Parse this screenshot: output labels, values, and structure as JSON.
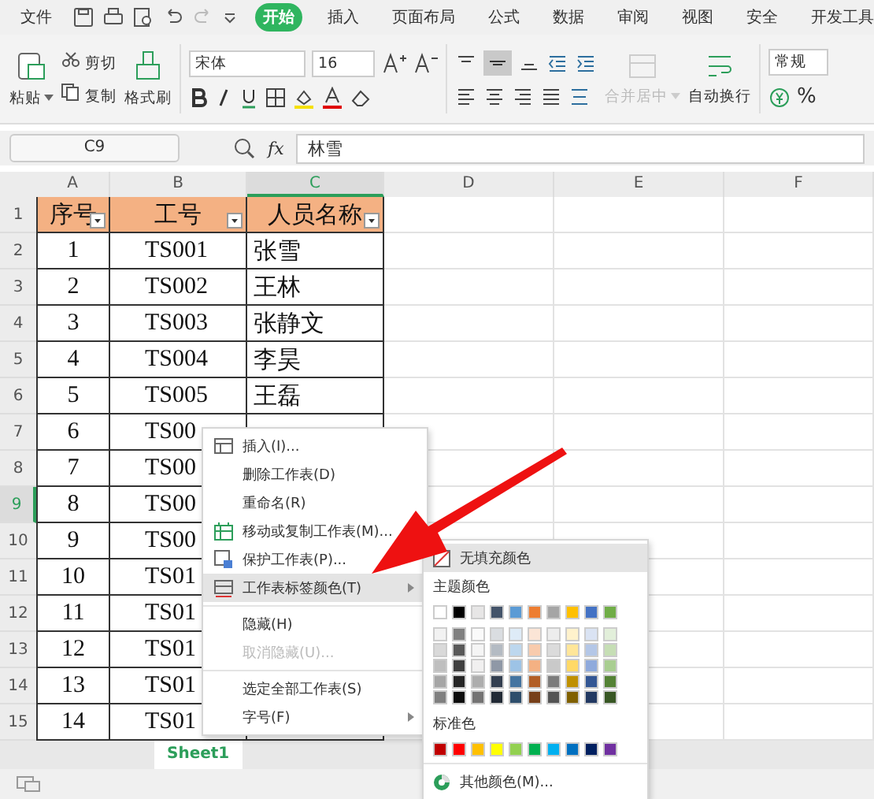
{
  "menu_bar": {
    "file": "文件",
    "tabs": [
      {
        "label": "开始",
        "selected": true
      },
      {
        "label": "插入",
        "selected": false
      },
      {
        "label": "页面布局",
        "selected": false
      },
      {
        "label": "公式",
        "selected": false
      },
      {
        "label": "数据",
        "selected": false
      },
      {
        "label": "审阅",
        "selected": false
      },
      {
        "label": "视图",
        "selected": false
      },
      {
        "label": "安全",
        "selected": false
      },
      {
        "label": "开发工具",
        "selected": false
      }
    ]
  },
  "ribbon": {
    "paste": "粘贴",
    "cut": "剪切",
    "copy": "复制",
    "format_painter": "格式刷",
    "font": "宋体",
    "font_size": "16",
    "merge": {
      "label": "合并居中",
      "disabled": true
    },
    "wrap": "自动换行",
    "number_format": "常规",
    "percent": "%"
  },
  "formula_bar": {
    "name_box": "C9",
    "fx_label": "fx",
    "formula": "林雪"
  },
  "sheet": {
    "columns": [
      {
        "label": "A",
        "selected": false
      },
      {
        "label": "B",
        "selected": false
      },
      {
        "label": "C",
        "selected": true
      },
      {
        "label": "D",
        "selected": false
      },
      {
        "label": "E",
        "selected": false
      },
      {
        "label": "F",
        "selected": false
      }
    ],
    "rows": [
      {
        "number": "1",
        "selected": false,
        "kind": "header",
        "cells": [
          "序号",
          "工号",
          "人员名称"
        ]
      },
      {
        "number": "2",
        "selected": false,
        "kind": "data",
        "cells": [
          "1",
          "TS001",
          "张雪"
        ]
      },
      {
        "number": "3",
        "selected": false,
        "kind": "data",
        "cells": [
          "2",
          "TS002",
          "王林"
        ]
      },
      {
        "number": "4",
        "selected": false,
        "kind": "data",
        "cells": [
          "3",
          "TS003",
          "张静文"
        ]
      },
      {
        "number": "5",
        "selected": false,
        "kind": "data",
        "cells": [
          "4",
          "TS004",
          "李昊"
        ]
      },
      {
        "number": "6",
        "selected": false,
        "kind": "data",
        "cells": [
          "5",
          "TS005",
          "王磊"
        ]
      },
      {
        "number": "7",
        "selected": false,
        "kind": "data",
        "cells": [
          "6",
          "TS00"
        ]
      },
      {
        "number": "8",
        "selected": false,
        "kind": "data",
        "cells": [
          "7",
          "TS00"
        ]
      },
      {
        "number": "9",
        "selected": true,
        "kind": "data",
        "cells": [
          "8",
          "TS00"
        ]
      },
      {
        "number": "10",
        "selected": false,
        "kind": "data",
        "cells": [
          "9",
          "TS00"
        ]
      },
      {
        "number": "11",
        "selected": false,
        "kind": "data",
        "cells": [
          "10",
          "TS01"
        ]
      },
      {
        "number": "12",
        "selected": false,
        "kind": "data",
        "cells": [
          "11",
          "TS01"
        ]
      },
      {
        "number": "13",
        "selected": false,
        "kind": "data",
        "cells": [
          "12",
          "TS01"
        ]
      },
      {
        "number": "14",
        "selected": false,
        "kind": "data",
        "cells": [
          "13",
          "TS01"
        ]
      },
      {
        "number": "15",
        "selected": false,
        "kind": "data",
        "cells": [
          "14",
          "TS01"
        ]
      }
    ]
  },
  "sheet_tabs": [
    {
      "label": "Sheet1",
      "selected": true
    }
  ],
  "context_menu": [
    {
      "label": "插入(I)...",
      "kind": "table",
      "disabled": false,
      "highlighted": false,
      "submenu": false
    },
    {
      "label": "删除工作表(D)",
      "kind": "plain",
      "disabled": false,
      "highlighted": false,
      "submenu": false
    },
    {
      "label": "重命名(R)",
      "kind": "plain",
      "disabled": false,
      "highlighted": false,
      "submenu": false
    },
    {
      "label": "移动或复制工作表(M)...",
      "kind": "move",
      "disabled": false,
      "highlighted": false,
      "submenu": false
    },
    {
      "label": "保护工作表(P)...",
      "kind": "protect",
      "disabled": false,
      "highlighted": false,
      "submenu": false
    },
    {
      "label": "工作表标签颜色(T)",
      "kind": "tabcolor",
      "disabled": false,
      "highlighted": true,
      "submenu": true
    },
    {
      "label": "隐藏(H)",
      "kind": "plain",
      "disabled": false,
      "highlighted": false,
      "submenu": false
    },
    {
      "label": "取消隐藏(U)...",
      "kind": "plain",
      "disabled": true,
      "highlighted": false,
      "submenu": false
    },
    {
      "label": "选定全部工作表(S)",
      "kind": "plain",
      "disabled": false,
      "highlighted": false,
      "submenu": false
    },
    {
      "label": "字号(F)",
      "kind": "plain",
      "disabled": false,
      "highlighted": false,
      "submenu": true
    }
  ],
  "color_submenu": {
    "no_fill": "无填充颜色",
    "theme_title": "主题颜色",
    "theme_colors": [
      {
        "color": "#ffffff"
      },
      {
        "color": "#000000"
      },
      {
        "color": "#e7e6e6"
      },
      {
        "color": "#44546a"
      },
      {
        "color": "#5b9bd5"
      },
      {
        "color": "#ed7d31"
      },
      {
        "color": "#a5a5a5"
      },
      {
        "color": "#ffc000"
      },
      {
        "color": "#4472c4"
      },
      {
        "color": "#70ad47"
      }
    ],
    "standard_title": "标准色",
    "standard_colors": [
      {
        "color": "#c00000"
      },
      {
        "color": "#ff0000"
      },
      {
        "color": "#ffc000"
      },
      {
        "color": "#ffff00"
      },
      {
        "color": "#92d050"
      },
      {
        "color": "#00b050"
      },
      {
        "color": "#00b0f0"
      },
      {
        "color": "#0070c0"
      },
      {
        "color": "#002060"
      },
      {
        "color": "#7030a0"
      }
    ],
    "more": "其他颜色(M)..."
  }
}
